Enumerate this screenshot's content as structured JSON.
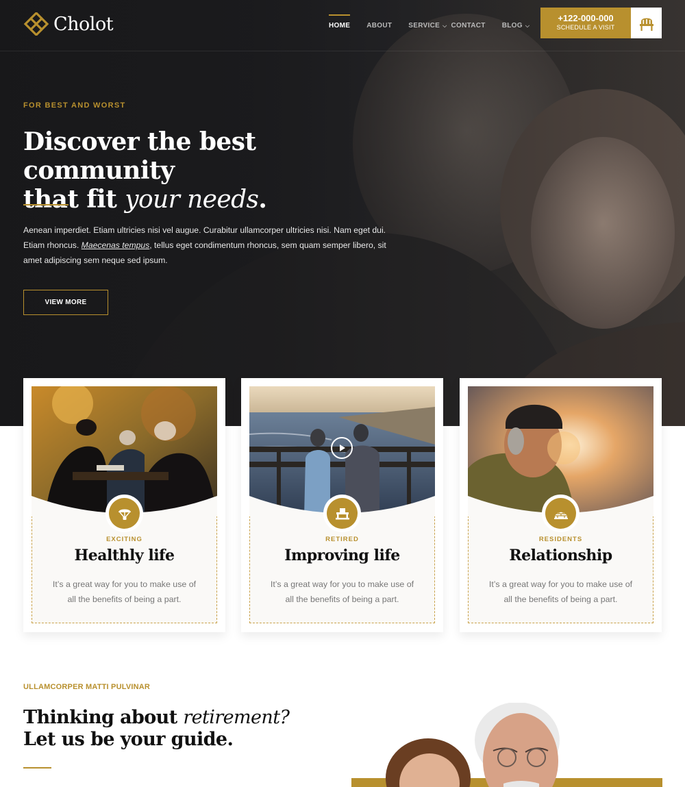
{
  "brand": {
    "name": "Cholot",
    "accent": "#b8902e"
  },
  "nav": {
    "items": [
      {
        "label": "HOME",
        "active": true,
        "dropdown": false
      },
      {
        "label": "ABOUT",
        "active": false,
        "dropdown": false
      },
      {
        "label": "SERVICE",
        "active": false,
        "dropdown": true
      },
      {
        "label": "CONTACT",
        "active": false,
        "dropdown": false
      },
      {
        "label": "BLOG",
        "active": false,
        "dropdown": true
      }
    ]
  },
  "cta": {
    "phone": "+122-000-000",
    "label": "SCHEDULE A VISIT",
    "icon": "chair-icon"
  },
  "hero": {
    "eyebrow": "FOR BEST AND WORST",
    "title_line1": "Discover the best community",
    "title_line2_prefix": "that fit ",
    "title_line2_italic": "your needs",
    "title_line2_suffix": ".",
    "desc_part1": "Aenean imperdiet. Etiam ultricies nisi vel augue. Curabitur ullamcorper ultricies nisi. Nam eget dui. Etiam rhoncus. ",
    "desc_link": "Maecenas tempus",
    "desc_part2": ", tellus eget condimentum rhoncus, sem quam semper libero, sit amet adipiscing sem neque sed ipsum.",
    "button": "VIEW MORE"
  },
  "cards": [
    {
      "tag": "EXCITING",
      "title": "Healthly life",
      "text": "It’s a great way for you to make use of all the benefits of being a part.",
      "icon": "parachute-icon"
    },
    {
      "tag": "RETIRED",
      "title": "Improving life",
      "text": "It’s a great way for you to make use of all the benefits of being a part.",
      "icon": "pier-icon",
      "has_video": true
    },
    {
      "tag": "RESIDENTS",
      "title": "Relationship",
      "text": "It’s a great way for you to make use of all the benefits of being a part.",
      "icon": "igloo-icon"
    }
  ],
  "section2": {
    "eyebrow": "ULLAMCORPER MATTI PULVINAR",
    "title_prefix": "Thinking about ",
    "title_italic": "retirement?",
    "title_line2": "Let us be your guide."
  }
}
